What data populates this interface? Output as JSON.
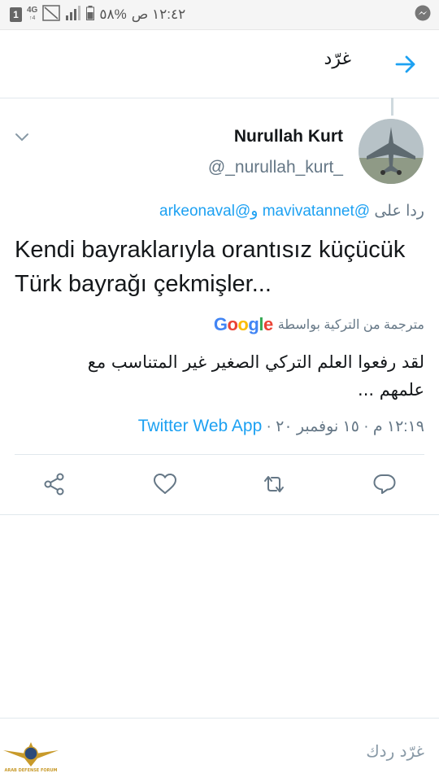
{
  "status_bar": {
    "time": "١٢:٤٢ ص",
    "battery": "%٥٨",
    "network": "4G",
    "network_sub": "4↑",
    "notification_count": "1"
  },
  "header": {
    "title": "غرّد"
  },
  "tweet": {
    "display_name": "Nurullah Kurt",
    "handle": "@_nurullah_kurt_",
    "reply_prefix": "ردا على",
    "reply_user_1": "@mavivatannet",
    "reply_conjunction": "و",
    "reply_user_2": "@arkeonaval",
    "text": "Kendi bayraklarıyla orantısız küçücük Türk bayrağı çekmişler...",
    "translated_by": "مترجمة من التركية بواسطة",
    "translation_provider": "Google",
    "translation": "لقد رفعوا العلم التركي الصغير غير المتناسب مع علمهم ...",
    "timestamp": "١٢:١٩ م · ١٥ نوفمبر ٢٠ ·",
    "source": "Twitter Web App"
  },
  "compose": {
    "placeholder": "غرّد ردك"
  },
  "watermark": {
    "label": "ARAB DEFENSE FORUM"
  },
  "colors": {
    "accent": "#1da1f2",
    "text": "#14171a",
    "muted": "#657786",
    "icon": "#657786"
  },
  "icons": [
    "messenger-icon",
    "notification-badge-icon",
    "lte-icon",
    "image-icon",
    "signal-icon",
    "battery-icon",
    "back-arrow-icon",
    "chevron-down-icon",
    "share-icon",
    "like-icon",
    "retweet-icon",
    "reply-icon"
  ]
}
